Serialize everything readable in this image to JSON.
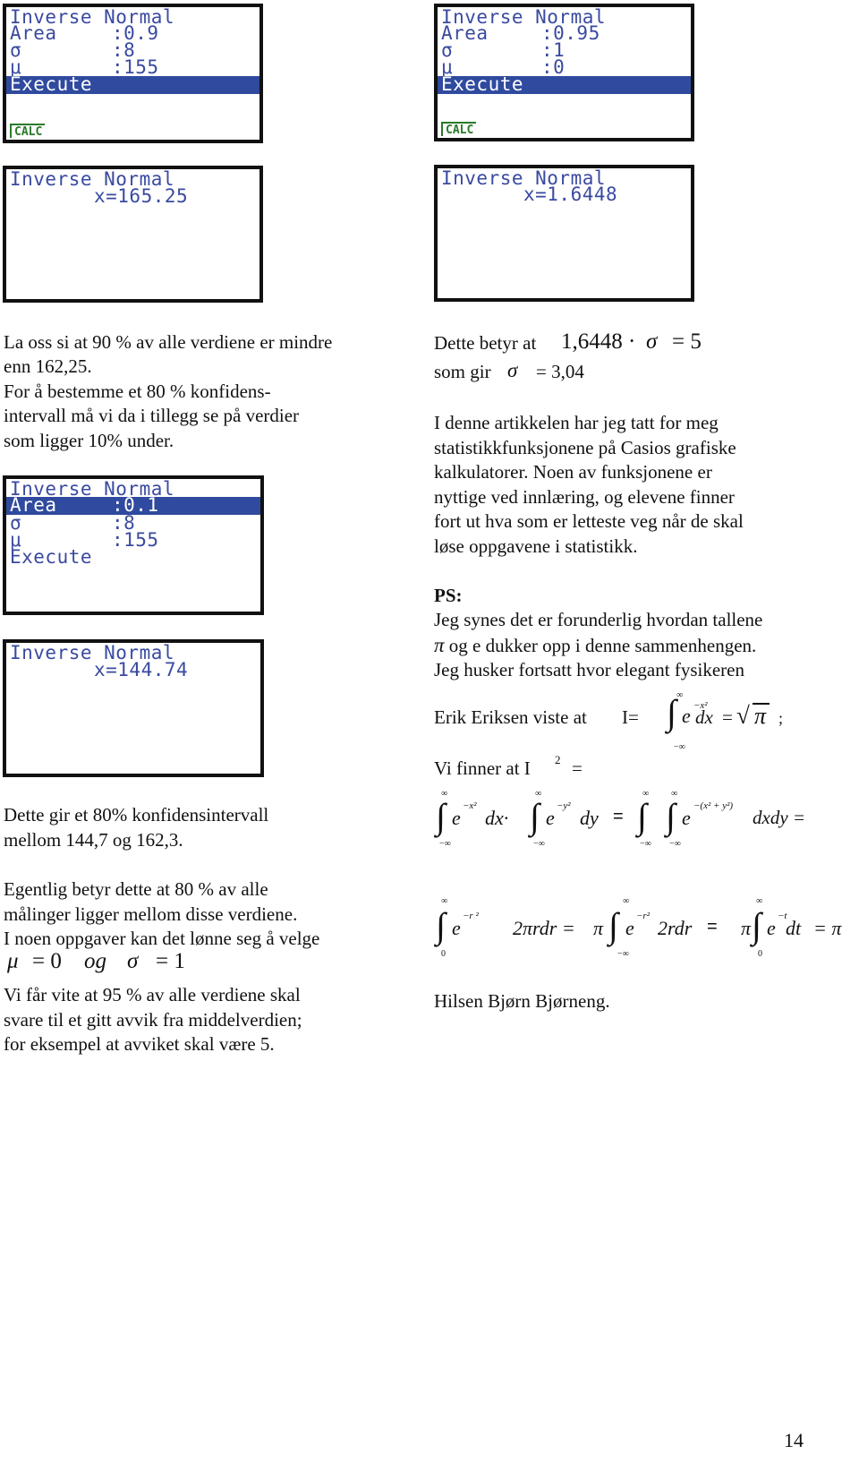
{
  "screens": [
    {
      "id": "s1",
      "title": "Inverse Normal",
      "rows": [
        {
          "label": "Area",
          "value": ":0.9"
        },
        {
          "label": "σ",
          "value": ":8"
        },
        {
          "label": "μ",
          "value": ":155"
        }
      ],
      "execute": "Execute",
      "selected": "execute",
      "tab": "CALC"
    },
    {
      "id": "s2",
      "title": "Inverse Normal",
      "result": "x=165.25"
    },
    {
      "id": "s3",
      "title": "Inverse Normal",
      "rows": [
        {
          "label": "Area",
          "value": ":0.1"
        },
        {
          "label": "σ",
          "value": ":8"
        },
        {
          "label": "μ",
          "value": ":155"
        }
      ],
      "execute": "Execute",
      "selected": "area"
    },
    {
      "id": "s4",
      "title": "Inverse Normal",
      "result": "x=144.74"
    },
    {
      "id": "s5",
      "title": "Inverse Normal",
      "rows": [
        {
          "label": "Area",
          "value": ":0.95"
        },
        {
          "label": "σ",
          "value": ":1"
        },
        {
          "label": "μ",
          "value": ":0"
        }
      ],
      "execute": "Execute",
      "selected": "execute",
      "tab": "CALC"
    },
    {
      "id": "s6",
      "title": "Inverse Normal",
      "result": "x=1.6448"
    }
  ],
  "left_col": {
    "para1": [
      "La oss si at 90 % av alle verdiene er mindre",
      "enn 162,25.",
      "For å bestemme et 80 % konfidens-",
      "intervall må vi da i tillegg  se på verdier",
      "som ligger 10% under."
    ],
    "para2": [
      "Dette gir et 80% konfidensintervall",
      "mellom 144,7 og 162,3."
    ],
    "para3": [
      "Egentlig betyr dette at 80 % av alle",
      "målinger ligger mellom disse verdiene.",
      "I noen oppgaver kan det lønne seg å velge"
    ],
    "formula_mu": {
      "mu": "μ",
      "eq1": "= 0",
      "og": "og",
      "sigma": "σ",
      "eq2": "= 1"
    },
    "para4": [
      "Vi får vite at 95 % av alle verdiene skal",
      "svare til et gitt avvik fra middelverdien;",
      "for eksempel at avviket skal være 5."
    ]
  },
  "right_col": {
    "line1": {
      "text": "Dette betyr  at",
      "num": "1,6448 ·",
      "sigma": "σ",
      "rest": "= 5"
    },
    "line2": {
      "text": "som gir",
      "sigma": "σ",
      "rest": "= 3,04"
    },
    "para1": [
      "I denne artikkelen har jeg tatt for meg",
      "statistikkfunksjonene  på Casios grafiske",
      "kalkulatorer. Noen av funksjonene er",
      "nyttige ved innlæring, og elevene finner",
      "fort ut hva som er letteste veg når de skal",
      "løse oppgavene i statistikk."
    ],
    "ps_heading": "PS:",
    "ps": [
      "Jeg synes det er forunderlig hvordan tallene",
      "og e dukker opp i denne sammenhengen.",
      "Jeg husker fortsatt hvor elegant fysikeren"
    ],
    "pi": "π",
    "erik": "Erik Eriksen viste at",
    "erik_eq": {
      "lhs": "I=",
      "upper": "∞",
      "lower": "−∞",
      "integrand": "e",
      "exp": "−x²",
      "dx": "dx",
      "eq": "=",
      "sqrt": "√",
      "pi": "π",
      "semi": ";"
    },
    "vi_finner": "Vi finner   at I",
    "vi_finner_sup": "2",
    "vi_finner_eq": "=",
    "eq2": {
      "inf": "∞",
      "minf": "−∞",
      "e": "e",
      "exp_x": "−x²",
      "dx": "dx·",
      "exp_y": "−y²",
      "dy": "dy",
      "eq": "=",
      "exp_xy": "−(x²  + y²)",
      "dxdy": "dxdy ="
    },
    "eq3": {
      "inf": "∞",
      "zero": "0",
      "minf": "−∞",
      "e": "e",
      "exp_r": "−r ²",
      "t1": "2πrdr =",
      "pi": "π",
      "exp_r2": "−r²",
      "t2": "2rdr",
      "eq": "=",
      "exp_t": "−t",
      "t3": "dt",
      "result": "= π"
    },
    "signature": "Hilsen  Bjørn Bjørneng."
  },
  "page_number": "14"
}
